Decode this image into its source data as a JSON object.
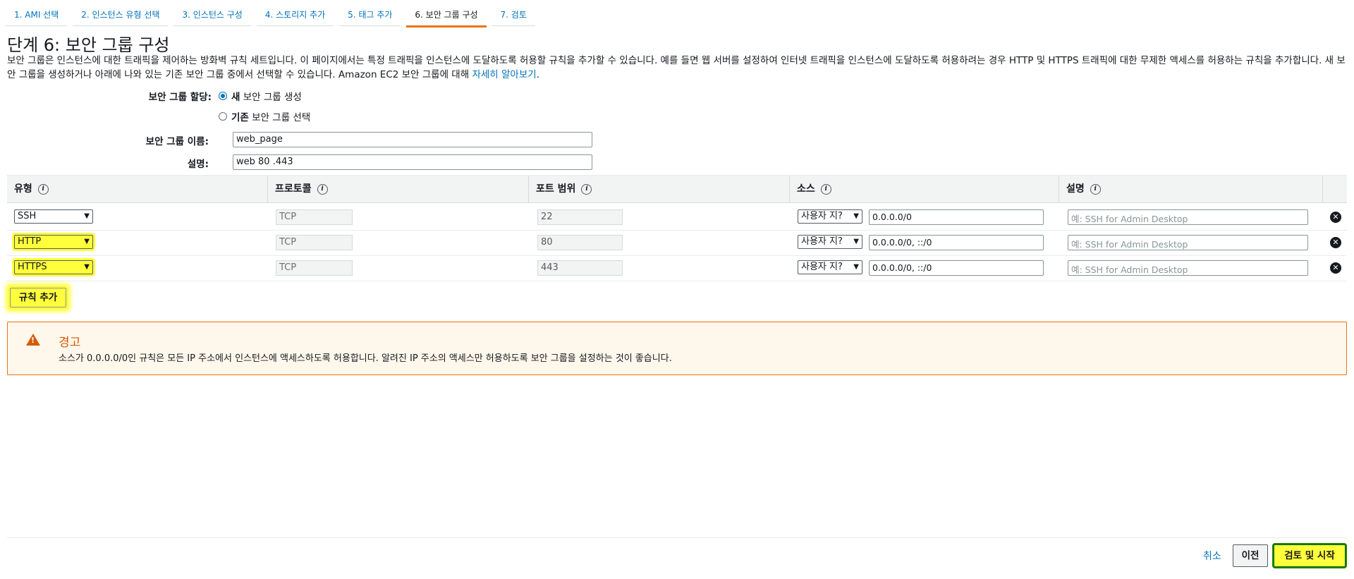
{
  "wizard_tabs": [
    {
      "label": "1. AMI 선택"
    },
    {
      "label": "2. 인스턴스 유형 선택"
    },
    {
      "label": "3. 인스턴스 구성"
    },
    {
      "label": "4. 스토리지 추가"
    },
    {
      "label": "5. 태그 추가"
    },
    {
      "label": "6. 보안 그룹 구성",
      "active": true
    },
    {
      "label": "7. 검토"
    }
  ],
  "page": {
    "title": "단계 6: 보안 그룹 구성",
    "description": "보안 그룹은 인스턴스에 대한 트래픽을 제어하는 방화벽 규칙 세트입니다. 이 페이지에서는 특정 트래픽을 인스턴스에 도달하도록 허용할 규칙을 추가할 수 있습니다. 예를 들면 웹 서버를 설정하여 인터넷 트래픽을 인스턴스에 도달하도록 허용하려는 경우 HTTP 및 HTTPS 트래픽에 대한 무제한 액세스를 허용하는 규칙을 추가합니다. 새 보안 그룹을 생성하거나 아래에 나와 있는 기존 보안 그룹 중에서 선택할 수 있습니다. Amazon EC2 보안 그룹에 대해 ",
    "learn_more": "자세히 알아보기",
    "period": "."
  },
  "assignment": {
    "label": "보안 그룹 할당:",
    "new_bold": "새",
    "new_rest": " 보안 그룹 생성",
    "existing_bold": "기존",
    "existing_rest": " 보안 그룹 선택",
    "selected": "new"
  },
  "fields": {
    "name_label": "보안 그룹 이름:",
    "name_value": "web_page",
    "desc_label": "설명:",
    "desc_value": "web 80 .443"
  },
  "table": {
    "headers": [
      "유형",
      "프로토콜",
      "포트 범위",
      "소스",
      "설명"
    ],
    "rows": [
      {
        "type": "SSH",
        "protocol": "TCP",
        "port": "22",
        "source_mode": "사용자 지정",
        "source_mode_shown": "사용자 지?",
        "source": "0.0.0.0/0",
        "desc_placeholder": "예: SSH for Admin Desktop",
        "highlighted": false
      },
      {
        "type": "HTTP",
        "protocol": "TCP",
        "port": "80",
        "source_mode": "사용자 지정",
        "source_mode_shown": "사용자 지?",
        "source": "0.0.0.0/0, ::/0",
        "desc_placeholder": "예: SSH for Admin Desktop",
        "highlighted": true
      },
      {
        "type": "HTTPS",
        "protocol": "TCP",
        "port": "443",
        "source_mode": "사용자 지정",
        "source_mode_shown": "사용자 지?",
        "source": "0.0.0.0/0, ::/0",
        "desc_placeholder": "예: SSH for Admin Desktop",
        "highlighted": true
      }
    ]
  },
  "add_rule_label": "규칙 추가",
  "warning": {
    "title": "경고",
    "text": "소스가 0.0.0.0/0인 규칙은 모든 IP 주소에서 인스턴스에 액세스하도록 허용합니다. 알려진 IP 주소의 액세스만 허용하도록 보안 그룹을 설정하는 것이 좋습니다."
  },
  "footer": {
    "cancel": "취소",
    "previous": "이전",
    "review_launch": "검토 및 시작"
  },
  "colors": {
    "link": "#0073bb",
    "accent": "#ec7211",
    "highlight": "#ffff3c",
    "warning_bg": "#fef7eb"
  }
}
